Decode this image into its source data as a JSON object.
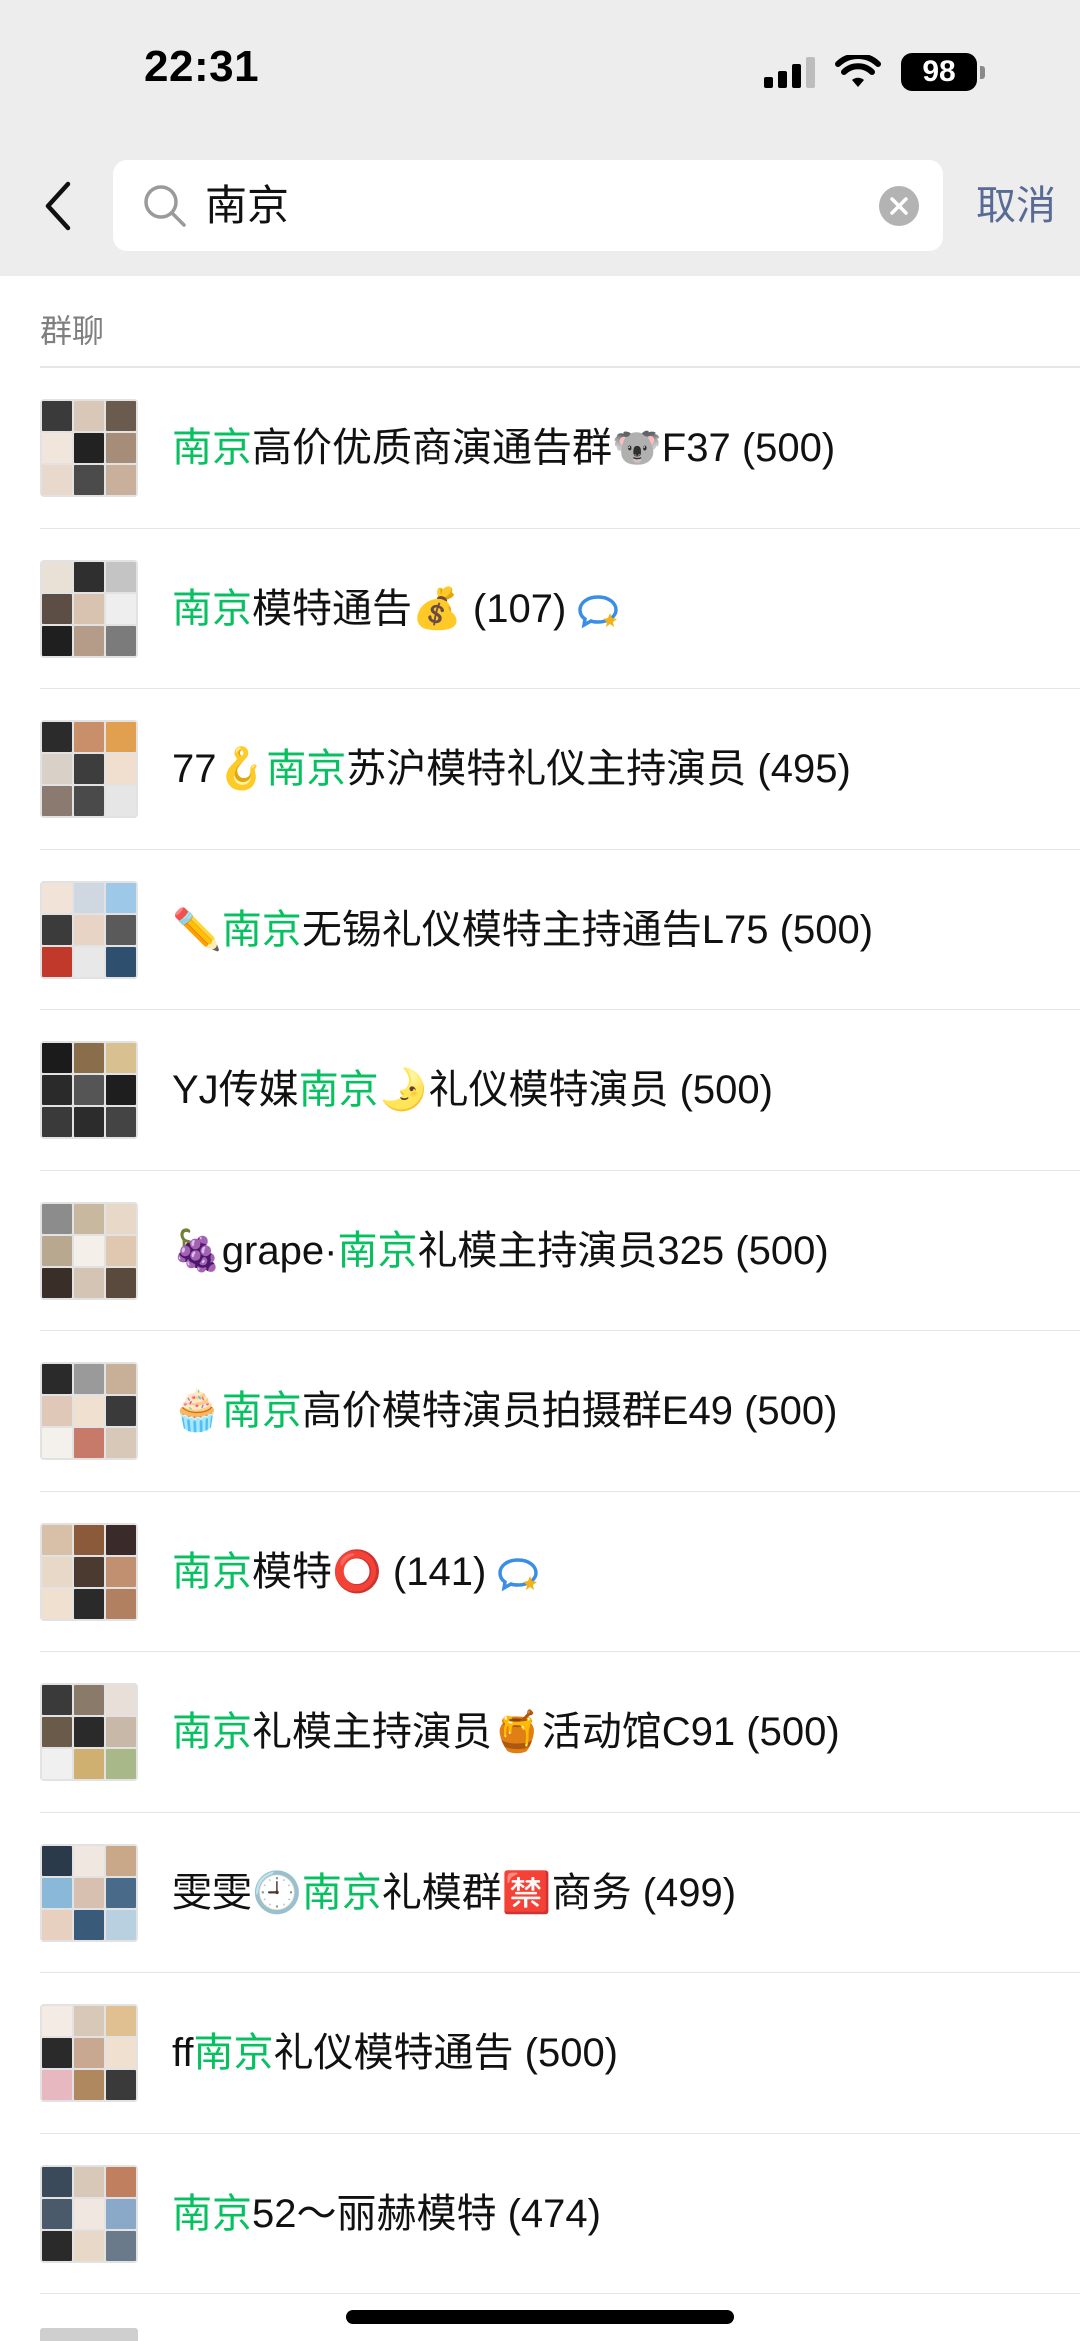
{
  "status_bar": {
    "time": "22:31",
    "battery": "98"
  },
  "search": {
    "query": "南京",
    "cancel_label": "取消"
  },
  "section": {
    "title": "群聊"
  },
  "colors": {
    "highlight": "#07c160",
    "cancel": "#576b95",
    "header_bg": "#ededed"
  },
  "results": [
    {
      "parts": [
        {
          "t": "南京",
          "hl": true
        },
        {
          "t": "高价优质商演通告群🐨F37 (500)"
        }
      ],
      "chat_icon": false
    },
    {
      "parts": [
        {
          "t": "南京",
          "hl": true
        },
        {
          "t": "模特通告💰 (107)"
        }
      ],
      "chat_icon": true
    },
    {
      "parts": [
        {
          "t": "77🪝"
        },
        {
          "t": "南京",
          "hl": true
        },
        {
          "t": "苏沪模特礼仪主持演员 (495)"
        }
      ],
      "chat_icon": false
    },
    {
      "parts": [
        {
          "t": "✏️"
        },
        {
          "t": "南京",
          "hl": true
        },
        {
          "t": "无锡礼仪模特主持通告L75 (500)"
        }
      ],
      "chat_icon": false
    },
    {
      "parts": [
        {
          "t": "YJ传媒"
        },
        {
          "t": "南京",
          "hl": true
        },
        {
          "t": "🌛礼仪模特演员 (500)"
        }
      ],
      "chat_icon": false
    },
    {
      "parts": [
        {
          "t": "🍇grape·"
        },
        {
          "t": "南京",
          "hl": true
        },
        {
          "t": "礼模主持演员325 (500)"
        }
      ],
      "chat_icon": false
    },
    {
      "parts": [
        {
          "t": "🧁"
        },
        {
          "t": "南京",
          "hl": true
        },
        {
          "t": "高价模特演员拍摄群E49 (500)"
        }
      ],
      "chat_icon": false
    },
    {
      "parts": [
        {
          "t": "南京",
          "hl": true
        },
        {
          "t": "模特⭕ (141)"
        }
      ],
      "chat_icon": true
    },
    {
      "parts": [
        {
          "t": "南京",
          "hl": true
        },
        {
          "t": "礼模主持演员🍯活动馆C91 (500)"
        }
      ],
      "chat_icon": false
    },
    {
      "parts": [
        {
          "t": "雯雯🕘"
        },
        {
          "t": "南京",
          "hl": true
        },
        {
          "t": "礼模群🈲商务 (499)"
        }
      ],
      "chat_icon": false
    },
    {
      "parts": [
        {
          "t": "ff"
        },
        {
          "t": "南京",
          "hl": true
        },
        {
          "t": "礼仪模特通告 (500)"
        }
      ],
      "chat_icon": false
    },
    {
      "parts": [
        {
          "t": "南京",
          "hl": true
        },
        {
          "t": "52～丽赫模特 (474)"
        }
      ],
      "chat_icon": false
    }
  ]
}
